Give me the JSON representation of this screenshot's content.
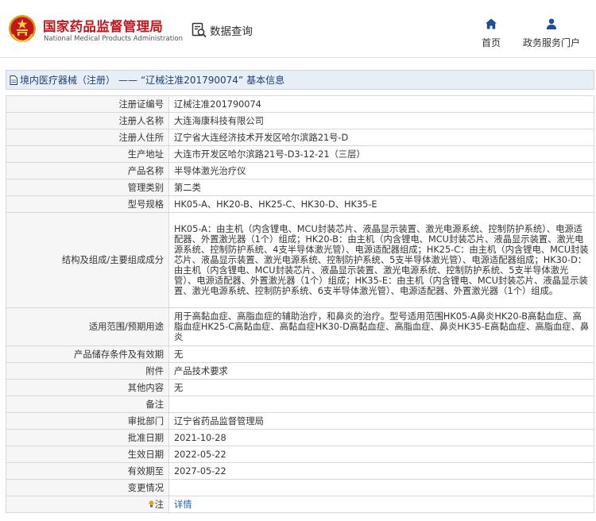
{
  "header": {
    "site_title_cn": "国家药品监督管理局",
    "site_title_en": "National Medical Products Administration",
    "query_label": "数据查询",
    "nav": [
      {
        "label": "首页",
        "icon": "home-icon"
      },
      {
        "label": "政务服务门户",
        "icon": "user-icon"
      }
    ]
  },
  "breadcrumb": {
    "category": "境内医疗器械（注册）",
    "separator": "——",
    "record": "“辽械注准201790074”",
    "suffix": "基本信息"
  },
  "details": {
    "rows": [
      {
        "label": "注册证编号",
        "value": "辽械注准201790074"
      },
      {
        "label": "注册人名称",
        "value": "大连海康科技有限公司"
      },
      {
        "label": "注册人住所",
        "value": "辽宁省大连经济技术开发区哈尔滨路21号-D"
      },
      {
        "label": "生产地址",
        "value": "大连市开发区哈尔滨路21号-D3-12-21（三层）"
      },
      {
        "label": "产品名称",
        "value": "半导体激光治疗仪"
      },
      {
        "label": "管理类别",
        "value": "第二类"
      },
      {
        "label": "型号规格",
        "value": "HK05-A、HK20-B、HK25-C、HK30-D、HK35-E"
      },
      {
        "label": "结构及组成/主要组成成分",
        "value": "HK05-A：由主机（内含锂电、MCU封装芯片、液晶显示装置、激光电源系统、控制防护系统）、电源适配器、外置激光器（1个）组成；HK20-B：由主机（内含锂电、MCU封装芯片、液晶显示装置、激光电源系统、控制防护系统、4支半导体激光管）、电源适配器组成；HK25-C：由主机（内含锂电、MCU封装芯片、液晶显示装置、激光电源系统、控制防护系统、5支半导体激光管）、电源适配器组成；HK30-D：由主机（内含锂电、MCU封装芯片、液晶显示装置、激光电源系统、控制防护系统、5支半导体激光管）、电源适配器、外置激光器（1个）组成；HK35-E：由主机（内含锂电、MCU封装芯片、液晶显示装置、激光电源系统、控制防护系统、6支半导体激光管）、电源适配器、外置激光器（1个）组成。"
      },
      {
        "label": "适用范围/预期用途",
        "value": "用于高黏血症、高脂血症的辅助治疗，和鼻炎的治疗。型号适用范围HK05-A鼻炎HK20-B高黏血症、高脂血症HK25-C高黏血症、高黏血症HK30-D高黏血症、高脂血症、鼻炎HK35-E高黏血症、高脂血症、鼻炎"
      },
      {
        "label": "产品储存条件及有效期",
        "value": "无"
      },
      {
        "label": "附件",
        "value": "产品技术要求"
      },
      {
        "label": "其他内容",
        "value": "无"
      },
      {
        "label": "备注",
        "value": ""
      },
      {
        "label": "审批部门",
        "value": "辽宁省药品监督管理局"
      },
      {
        "label": "批准日期",
        "value": "2021-10-28"
      },
      {
        "label": "生效日期",
        "value": "2022-05-22"
      },
      {
        "label": "有效期至",
        "value": "2027-05-22"
      },
      {
        "label": "变更情况",
        "value": ""
      },
      {
        "label": "注",
        "value": "详情"
      }
    ]
  },
  "colors": {
    "brand_red": "#c6161d",
    "link_blue": "#1e63b6",
    "titlebar_bg": "#e8eef6"
  }
}
